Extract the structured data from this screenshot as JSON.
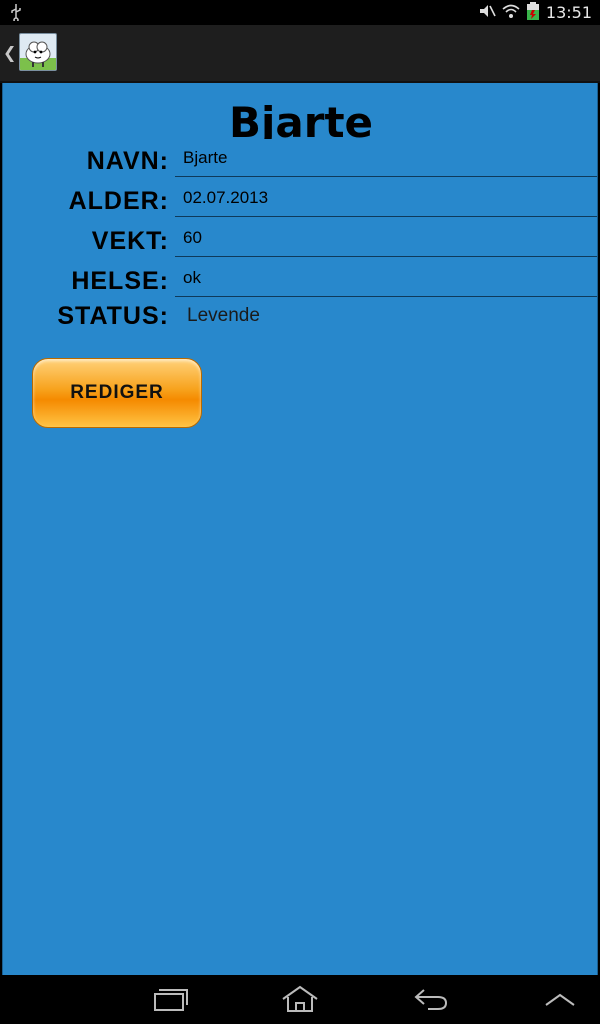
{
  "status_bar": {
    "time": "13:51",
    "icons": [
      "usb-icon",
      "mute-icon",
      "wifi-icon",
      "battery-icon"
    ]
  },
  "action_bar": {
    "up_icon": "chevron-left-icon",
    "app_icon": "sheep-logo-icon"
  },
  "profile": {
    "title": "Bjarte",
    "fields": [
      {
        "label": "NAVN:",
        "value": "Bjarte"
      },
      {
        "label": "ALDER:",
        "value": "02.07.2013"
      },
      {
        "label": "VEKT:",
        "value": "60"
      },
      {
        "label": "HELSE:",
        "value": "ok"
      }
    ],
    "status_label": "STATUS:",
    "status_value": "Levende",
    "edit_button": "REDIGER"
  },
  "colors": {
    "content_bg": "#2888cc",
    "button_orange": "#f7a21c"
  },
  "nav_bar": {
    "buttons": [
      "recent-apps-icon",
      "home-icon",
      "back-icon",
      "menu-up-icon"
    ]
  }
}
